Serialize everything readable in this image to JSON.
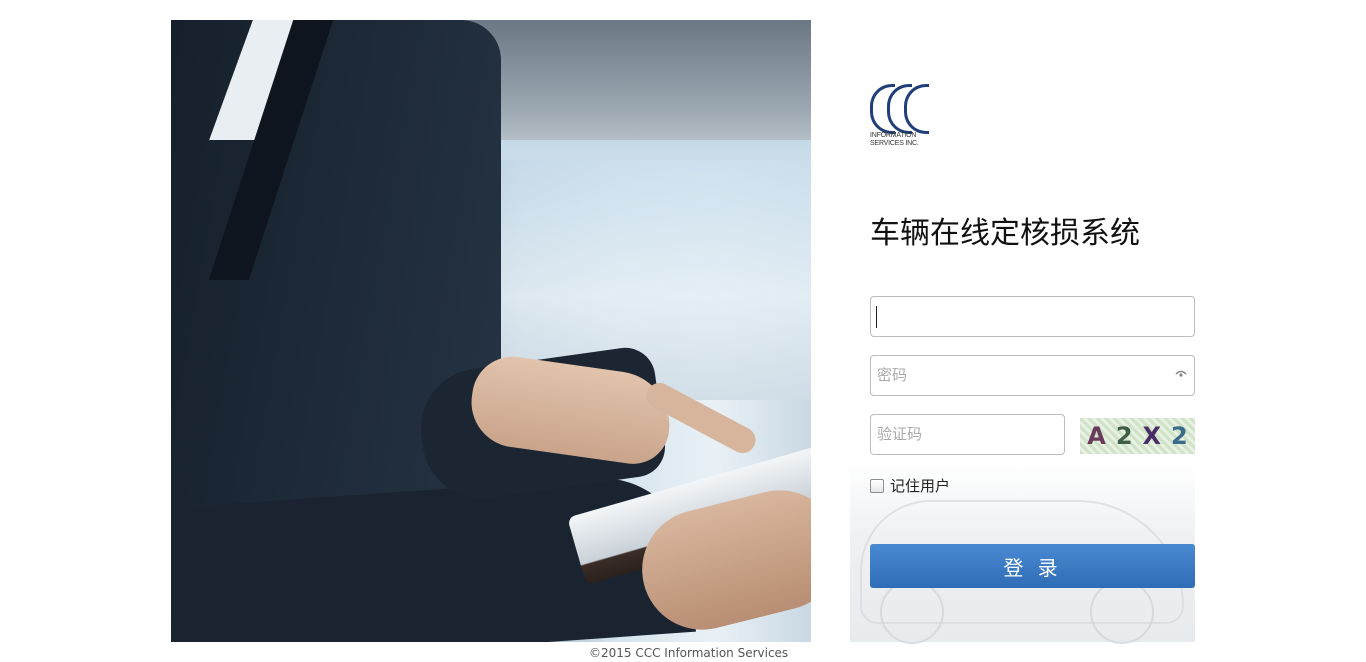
{
  "logo": {
    "line1": "INFORMATION",
    "line2": "SERVICES INC."
  },
  "title": "车辆在线定核损系统",
  "form": {
    "username_value": "",
    "password_placeholder": "密码",
    "captcha_placeholder": "验证码",
    "captcha_chars": [
      "A",
      "2",
      "X",
      "2"
    ],
    "remember_label": "记住用户",
    "login_label": "登 录"
  },
  "footer": "©2015 CCC Information Services",
  "colors": {
    "brand": "#1f3e7a",
    "login_button": "#3a7bc8"
  }
}
